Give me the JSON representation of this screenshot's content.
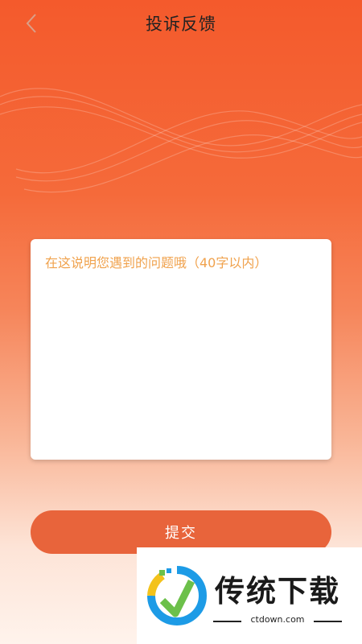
{
  "header": {
    "title": "投诉反馈",
    "back_icon": "chevron-left-icon"
  },
  "form": {
    "placeholder": "在这说明您遇到的问题哦（40字以内）",
    "value": ""
  },
  "submit": {
    "label": "提交"
  },
  "watermark": {
    "name": "传统下载",
    "url": "ctdown.com"
  },
  "colors": {
    "gradient_top": "#f45a2c",
    "gradient_bottom": "#fff3ec",
    "button": "#e8643b",
    "placeholder": "#f0a24d"
  }
}
